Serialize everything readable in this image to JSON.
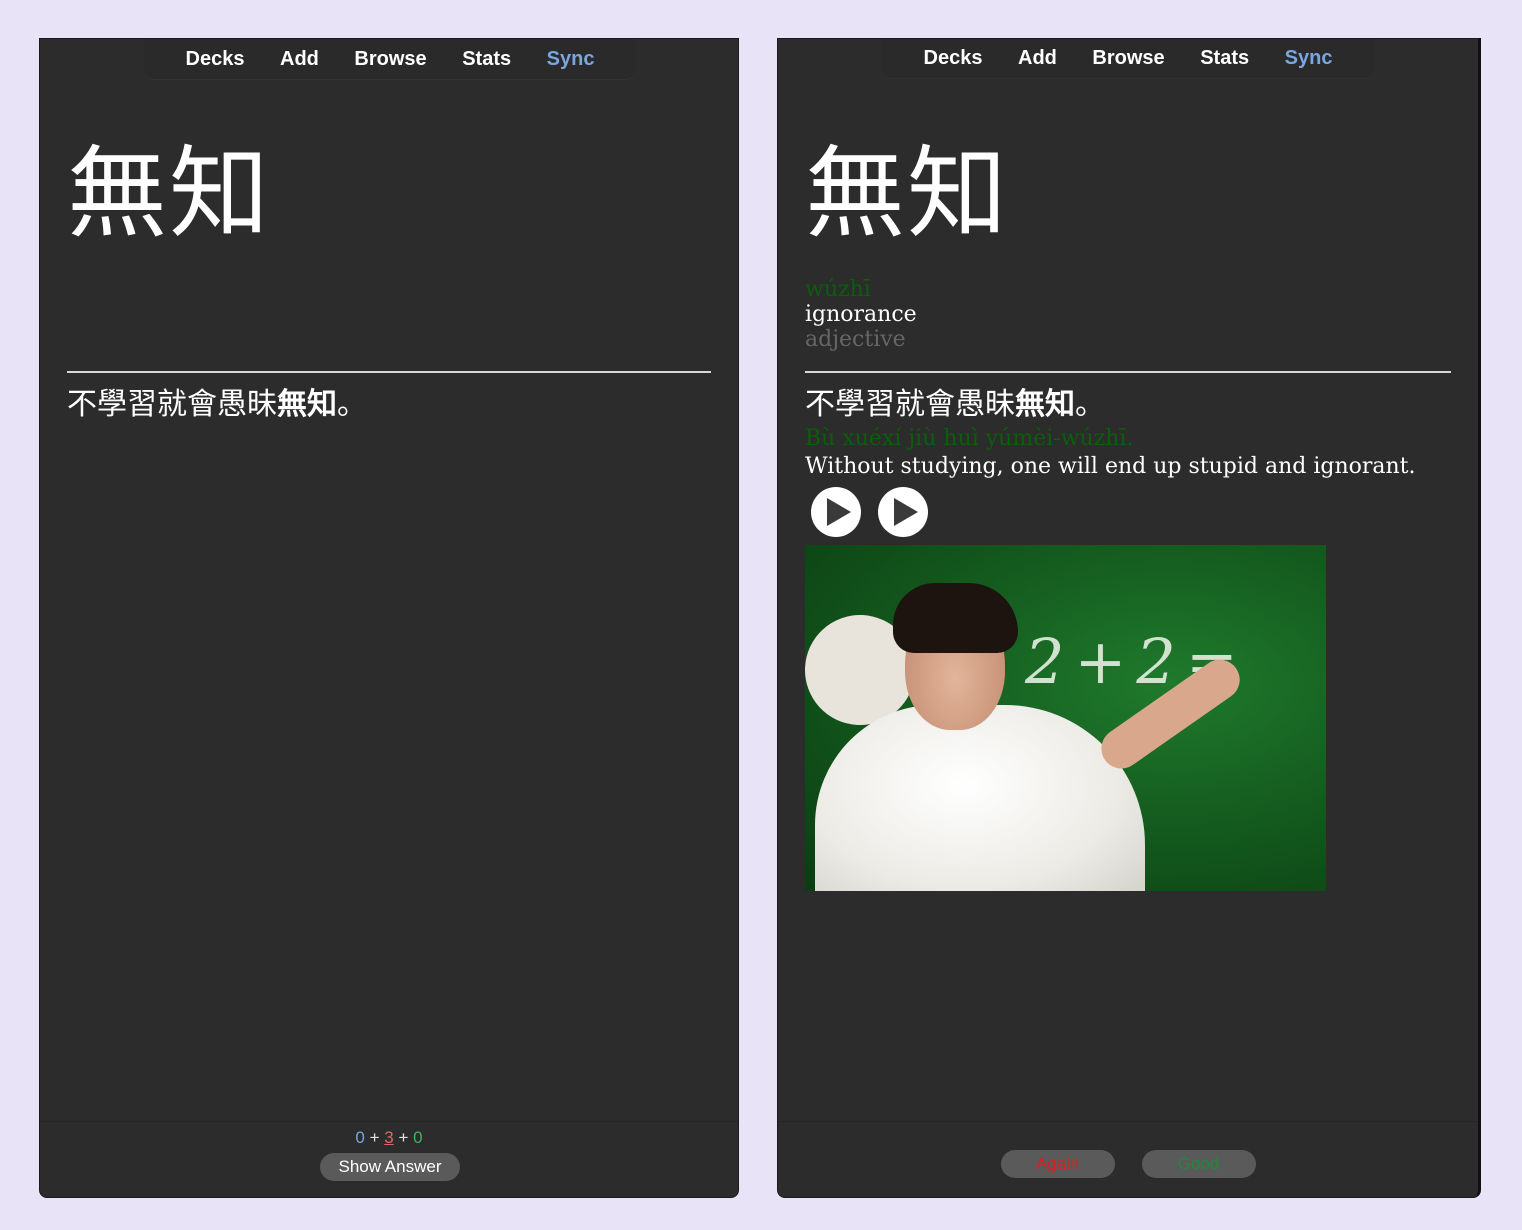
{
  "nav": {
    "items": [
      {
        "label": "Decks"
      },
      {
        "label": "Add"
      },
      {
        "label": "Browse"
      },
      {
        "label": "Stats"
      },
      {
        "label": "Sync"
      }
    ]
  },
  "front": {
    "word": "無知",
    "sentence_before": "不學習就會愚昧",
    "sentence_bold": "無知",
    "sentence_after": "。",
    "counts": {
      "new": "0",
      "sep1": "+",
      "learning": "3",
      "sep2": "+",
      "review": "0"
    },
    "show_answer_label": "Show Answer"
  },
  "back": {
    "word": "無知",
    "pinyin": "wúzhī",
    "meaning": "ignorance",
    "part_of_speech": "adjective",
    "sentence_before": "不學習就會愚昧",
    "sentence_bold": "無知",
    "sentence_after": "。",
    "sentence_pinyin": "Bù xuéxí jiù huì yúmèi-wúzhī.",
    "sentence_english": "Without studying, one will end up stupid and ignorant.",
    "audio_buttons": [
      {
        "icon": "play-icon"
      },
      {
        "icon": "play-icon"
      }
    ],
    "image": {
      "description": "Confused man scratching head at green chalkboard",
      "chalk_text": "2+2="
    },
    "answer_buttons": {
      "again_label": "Again",
      "good_label": "Good"
    }
  },
  "colors": {
    "background": "#e9e3f8",
    "panel": "#2c2c2c",
    "sync_accent": "#7aa6e0",
    "pinyin_green": "#0b5e0b",
    "again_red": "#d92020",
    "good_green": "#1f8a3a",
    "new_count": "#7aa6e0",
    "learn_count": "#e06666",
    "review_count": "#3cb45a"
  }
}
